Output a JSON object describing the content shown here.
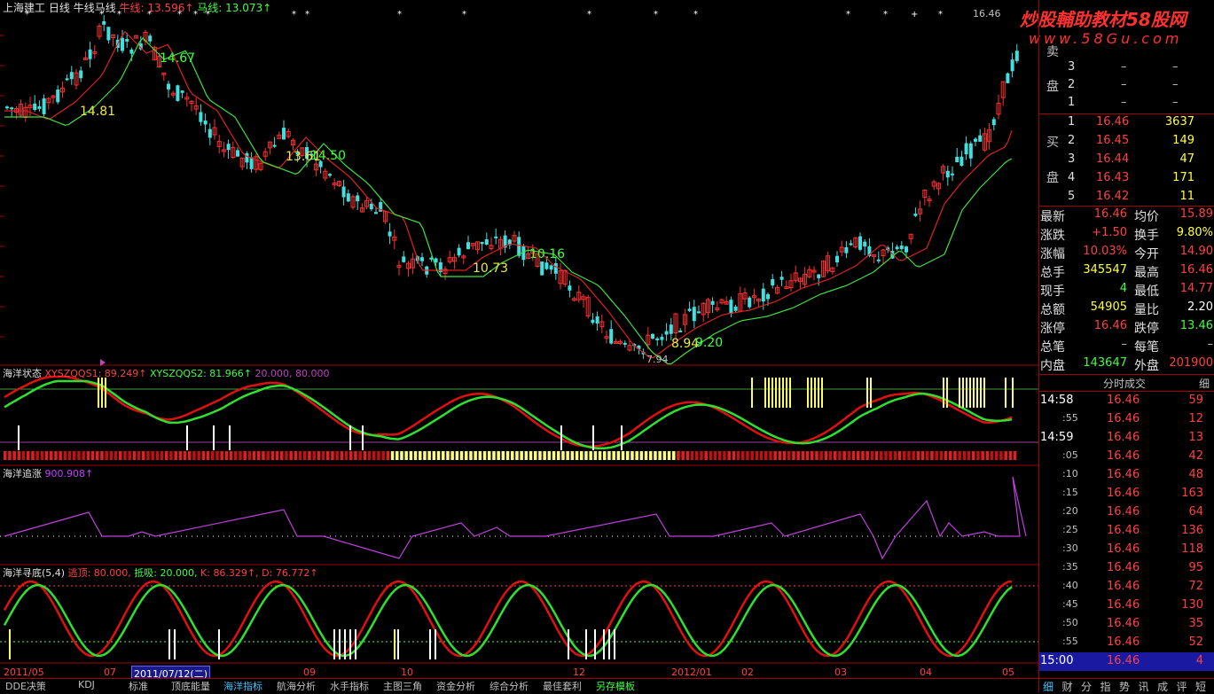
{
  "header": {
    "stock_name": "上海建工",
    "period": "日线",
    "ma_label": "牛线马线",
    "niu_label": "牛线:",
    "niu_value": "13.596↑",
    "ma_label2": "马线:",
    "ma_value": "13.073↑",
    "top_right_price": "16.46"
  },
  "watermark": {
    "line1": "炒股輔助教材58股网",
    "line2": "www.58Gu.com"
  },
  "main_chart_annotations": [
    "14.81",
    "14.67",
    "13.61",
    "14.50",
    "10.73",
    "10.16",
    "8.94",
    "9.20",
    "7.94"
  ],
  "panel1": {
    "title": "海洋状态",
    "label1": "XYSZQQS1:",
    "value1": "89.249↑",
    "label2": "XYSZQQS2:",
    "value2": "81.966↑",
    "extra": "20.000, 80.000"
  },
  "panel2": {
    "title": "海洋追涨",
    "value": "900.908↑"
  },
  "panel3": {
    "title": "海洋寻底(5,4)",
    "l1": "逃顶:",
    "v1": "80.000,",
    "l2": "抵吸:",
    "v2": "20.000,",
    "l3": "K:",
    "v3": "86.329↑,",
    "l4": "D:",
    "v4": "76.772↑"
  },
  "xaxis": {
    "labels": [
      "2011/05",
      "07",
      "2011/07/12(二)",
      "09",
      "10",
      "12",
      "2012/01",
      "02",
      "03",
      "04",
      "05"
    ]
  },
  "bottom_tabs": [
    "DDE决策",
    "KDJ",
    "标准",
    "顶底能量",
    "海洋指标",
    "航海分析",
    "水手指标",
    "主图三角",
    "资金分析",
    "综合分析",
    "最佳套利",
    "另存模板"
  ],
  "active_tab": "海洋指标",
  "right_bottom_tabs": [
    "细",
    "财",
    "分",
    "指",
    "势",
    "讯",
    "成",
    "评",
    "短"
  ],
  "sell_orders": {
    "label_top": "卖",
    "label_bottom": "盘",
    "rows": [
      {
        "n": "3",
        "p": "–",
        "v": "–"
      },
      {
        "n": "2",
        "p": "–",
        "v": "–"
      },
      {
        "n": "1",
        "p": "–",
        "v": "–"
      }
    ]
  },
  "buy_orders": {
    "label_top": "买",
    "label_bottom": "盘",
    "rows": [
      {
        "n": "1",
        "p": "16.46",
        "v": "3637"
      },
      {
        "n": "2",
        "p": "16.45",
        "v": "149"
      },
      {
        "n": "3",
        "p": "16.44",
        "v": "47"
      },
      {
        "n": "4",
        "p": "16.43",
        "v": "171"
      },
      {
        "n": "5",
        "p": "16.42",
        "v": "11"
      }
    ]
  },
  "quote": [
    {
      "l1": "最新",
      "v1": "16.46",
      "c1": "#ff4040",
      "l2": "均价",
      "v2": "15.89",
      "c2": "#ff4040"
    },
    {
      "l1": "涨跌",
      "v1": "+1.50",
      "c1": "#ff4040",
      "l2": "换手",
      "v2": "9.80%",
      "c2": "#ffff40"
    },
    {
      "l1": "涨幅",
      "v1": "10.03%",
      "c1": "#ff4040",
      "l2": "今开",
      "v2": "14.90",
      "c2": "#ff4040"
    },
    {
      "l1": "总手",
      "v1": "345547",
      "c1": "#ffff40",
      "l2": "最高",
      "v2": "16.46",
      "c2": "#ff4040"
    },
    {
      "l1": "现手",
      "v1": "4",
      "c1": "#40ff40",
      "l2": "最低",
      "v2": "14.77",
      "c2": "#ff4040"
    },
    {
      "l1": "总额",
      "v1": "54905",
      "c1": "#ffff40",
      "l2": "量比",
      "v2": "2.20",
      "c2": "#ffffff"
    },
    {
      "l1": "涨停",
      "v1": "16.46",
      "c1": "#ff4040",
      "l2": "跌停",
      "v2": "13.46",
      "c2": "#40ff40"
    },
    {
      "l1": "总笔",
      "v1": "–",
      "c1": "#c0c0c0",
      "l2": "每笔",
      "v2": "–",
      "c2": "#c0c0c0"
    },
    {
      "l1": "内盘",
      "v1": "143647",
      "c1": "#40ff40",
      "l2": "外盘",
      "v2": "201900",
      "c2": "#ff4040"
    }
  ],
  "ticks_header": {
    "title": "分时成交",
    "right": "细"
  },
  "ticks": [
    {
      "t": "14:58",
      "p": "16.46",
      "v": "59"
    },
    {
      "t": ":55",
      "p": "16.46",
      "v": "12"
    },
    {
      "t": "14:59",
      "p": "16.46",
      "v": "13"
    },
    {
      "t": ":05",
      "p": "16.46",
      "v": "42"
    },
    {
      "t": ":10",
      "p": "16.46",
      "v": "48"
    },
    {
      "t": ":15",
      "p": "16.46",
      "v": "163"
    },
    {
      "t": ":20",
      "p": "16.46",
      "v": "64"
    },
    {
      "t": ":25",
      "p": "16.46",
      "v": "136"
    },
    {
      "t": ":30",
      "p": "16.46",
      "v": "118"
    },
    {
      "t": ":35",
      "p": "16.46",
      "v": "95"
    },
    {
      "t": ":40",
      "p": "16.46",
      "v": "72"
    },
    {
      "t": ":45",
      "p": "16.46",
      "v": "130"
    },
    {
      "t": ":50",
      "p": "16.46",
      "v": "35"
    },
    {
      "t": ":55",
      "p": "16.46",
      "v": "52"
    },
    {
      "t": "15:00",
      "p": "16.46",
      "v": "4"
    }
  ]
}
